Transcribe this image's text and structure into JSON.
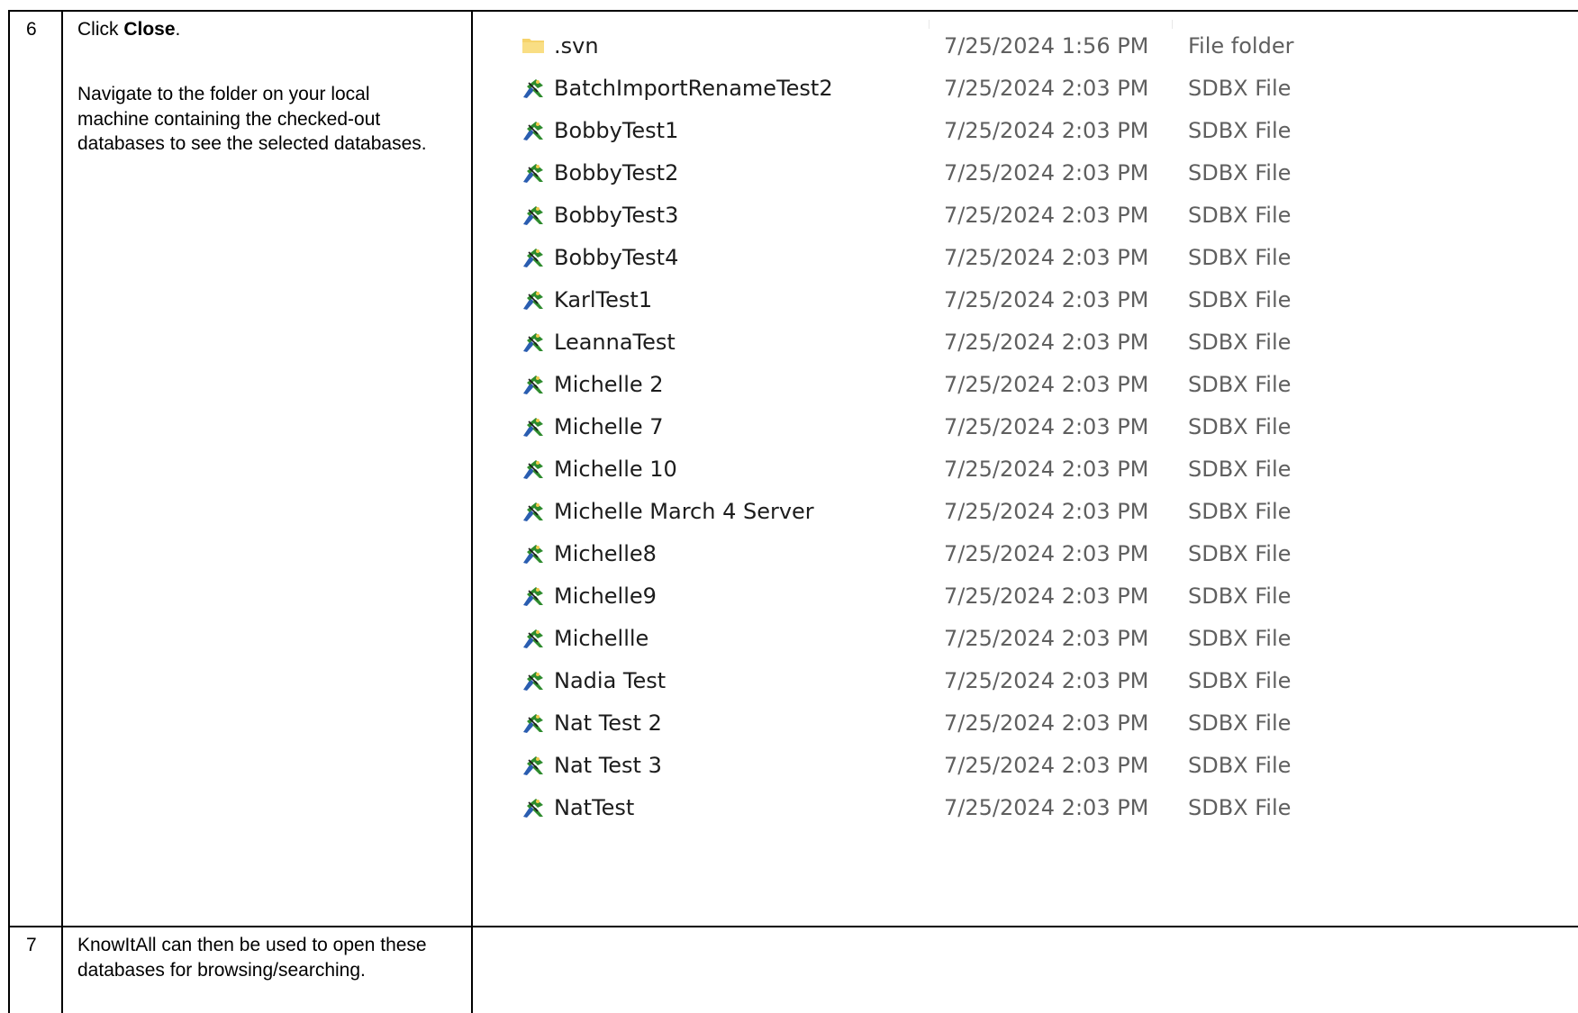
{
  "steps": [
    {
      "number": "6",
      "action_prefix": "Click ",
      "action_bold": "Close",
      "action_suffix": ".",
      "description": "Navigate to the folder on your local machine containing the checked-out databases to see the selected databases."
    },
    {
      "number": "7",
      "description": "KnowItAll can then be used to open these databases for browsing/searching."
    }
  ],
  "explorer": {
    "files": [
      {
        "name": ".svn",
        "date": "7/25/2024 1:56 PM",
        "type": "File folder",
        "icon": "folder-icon"
      },
      {
        "name": "BatchImportRenameTest2",
        "date": "7/25/2024 2:03 PM",
        "type": "SDBX File",
        "icon": "sdbx-file-icon"
      },
      {
        "name": "BobbyTest1",
        "date": "7/25/2024 2:03 PM",
        "type": "SDBX File",
        "icon": "sdbx-file-icon"
      },
      {
        "name": "BobbyTest2",
        "date": "7/25/2024 2:03 PM",
        "type": "SDBX File",
        "icon": "sdbx-file-icon"
      },
      {
        "name": "BobbyTest3",
        "date": "7/25/2024 2:03 PM",
        "type": "SDBX File",
        "icon": "sdbx-file-icon"
      },
      {
        "name": "BobbyTest4",
        "date": "7/25/2024 2:03 PM",
        "type": "SDBX File",
        "icon": "sdbx-file-icon"
      },
      {
        "name": "KarlTest1",
        "date": "7/25/2024 2:03 PM",
        "type": "SDBX File",
        "icon": "sdbx-file-icon"
      },
      {
        "name": "LeannaTest",
        "date": "7/25/2024 2:03 PM",
        "type": "SDBX File",
        "icon": "sdbx-file-icon"
      },
      {
        "name": "Michelle 2",
        "date": "7/25/2024 2:03 PM",
        "type": "SDBX File",
        "icon": "sdbx-file-icon"
      },
      {
        "name": "Michelle 7",
        "date": "7/25/2024 2:03 PM",
        "type": "SDBX File",
        "icon": "sdbx-file-icon"
      },
      {
        "name": "Michelle 10",
        "date": "7/25/2024 2:03 PM",
        "type": "SDBX File",
        "icon": "sdbx-file-icon"
      },
      {
        "name": "Michelle March 4 Server",
        "date": "7/25/2024 2:03 PM",
        "type": "SDBX File",
        "icon": "sdbx-file-icon"
      },
      {
        "name": "Michelle8",
        "date": "7/25/2024 2:03 PM",
        "type": "SDBX File",
        "icon": "sdbx-file-icon"
      },
      {
        "name": "Michelle9",
        "date": "7/25/2024 2:03 PM",
        "type": "SDBX File",
        "icon": "sdbx-file-icon"
      },
      {
        "name": "Michellle",
        "date": "7/25/2024 2:03 PM",
        "type": "SDBX File",
        "icon": "sdbx-file-icon"
      },
      {
        "name": "Nadia Test",
        "date": "7/25/2024 2:03 PM",
        "type": "SDBX File",
        "icon": "sdbx-file-icon"
      },
      {
        "name": "Nat Test 2",
        "date": "7/25/2024 2:03 PM",
        "type": "SDBX File",
        "icon": "sdbx-file-icon"
      },
      {
        "name": "Nat Test 3",
        "date": "7/25/2024 2:03 PM",
        "type": "SDBX File",
        "icon": "sdbx-file-icon"
      },
      {
        "name": "NatTest",
        "date": "7/25/2024 2:03 PM",
        "type": "SDBX File",
        "icon": "sdbx-file-icon"
      }
    ]
  },
  "colors": {
    "folder": "#f6d36b",
    "sdbx_icon_green": "#2e8b2e",
    "sdbx_icon_blue": "#2a5db0",
    "meta_text": "#5f5f5f"
  }
}
